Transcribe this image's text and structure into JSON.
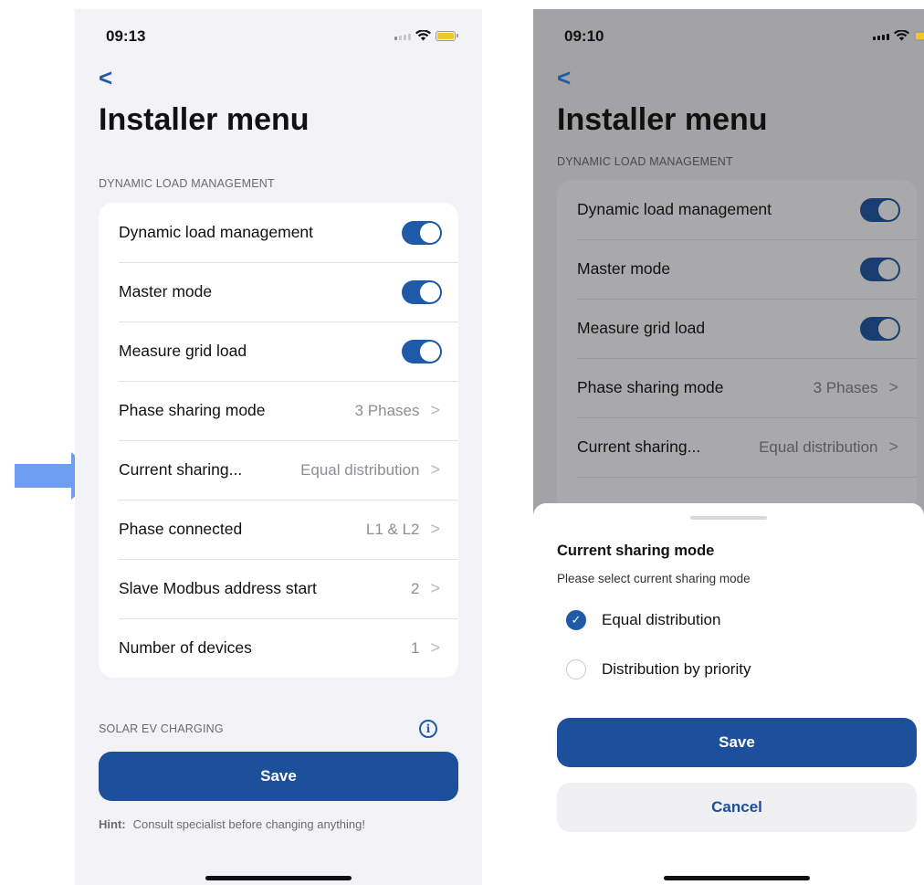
{
  "left_screen": {
    "status": {
      "time": "09:13"
    },
    "nav": {
      "back": "<"
    },
    "title": "Installer menu",
    "section_dlm": "DYNAMIC LOAD MANAGEMENT",
    "rows": [
      {
        "label": "Dynamic load management",
        "toggle_on": true
      },
      {
        "label": "Master mode",
        "toggle_on": true
      },
      {
        "label": "Measure grid load",
        "toggle_on": true
      },
      {
        "label": "Phase sharing mode",
        "value": "3 Phases",
        "chevron": ">"
      },
      {
        "label": "Current sharing...",
        "value": "Equal distribution",
        "chevron": ">"
      },
      {
        "label": "Phase connected",
        "value": "L1 & L2",
        "chevron": ">"
      },
      {
        "label": "Slave Modbus address start",
        "value": "2",
        "chevron": ">"
      },
      {
        "label": "Number of devices",
        "value": "1",
        "chevron": ">"
      }
    ],
    "section_solar": "SOLAR EV CHARGING",
    "info_glyph": "i",
    "save_label": "Save",
    "hint_label": "Hint:",
    "hint_text": "Consult specialist before changing anything!"
  },
  "right_screen": {
    "status": {
      "time": "09:10"
    },
    "nav": {
      "back": "<"
    },
    "title": "Installer menu",
    "section_dlm": "DYNAMIC LOAD MANAGEMENT",
    "rows": [
      {
        "label": "Dynamic load management",
        "toggle_on": true
      },
      {
        "label": "Master mode",
        "toggle_on": true
      },
      {
        "label": "Measure grid load",
        "toggle_on": true
      },
      {
        "label": "Phase sharing mode",
        "value": "3 Phases",
        "chevron": ">"
      },
      {
        "label": "Current sharing...",
        "value": "Equal distribution",
        "chevron": ">"
      }
    ],
    "sheet": {
      "title": "Current sharing mode",
      "subtitle": "Please select current sharing mode",
      "options": [
        {
          "label": "Equal distribution",
          "selected": true
        },
        {
          "label": "Distribution by priority",
          "selected": false
        }
      ],
      "save_label": "Save",
      "cancel_label": "Cancel"
    }
  },
  "colors": {
    "accent": "#1f5aa8",
    "button": "#1c4f9c",
    "arrow": "#6e9ef0",
    "toggle": "#1f5aa8",
    "battery": "#f4c430"
  },
  "icons": {
    "arrow": "right-arrow-icon",
    "check": "checkmark-icon",
    "info": "info-icon",
    "wifi": "wifi-icon",
    "battery": "battery-icon",
    "signal": "signal-icon"
  }
}
